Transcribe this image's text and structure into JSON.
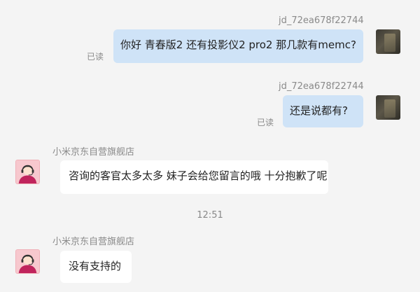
{
  "messages": [
    {
      "sender": "jd_72ea678f22744",
      "text": "你好 青春版2 还有投影仪2 pro2 那几款有memc?",
      "read_status": "已读"
    },
    {
      "sender": "jd_72ea678f22744",
      "text": "还是说都有?",
      "read_status": "已读"
    },
    {
      "sender": "小米京东自营旗舰店",
      "text": "咨询的客官太多太多 妹子会给您留言的哦 十分抱歉了呢"
    },
    {
      "timestamp": "12:51"
    },
    {
      "sender": "小米京东自营旗舰店",
      "text": "没有支持的"
    }
  ],
  "colors": {
    "outgoing_bubble": "#cfe3f7",
    "incoming_bubble": "#ffffff",
    "background": "#f4f4f4",
    "meta_text": "#8a8a8a"
  },
  "icons": {
    "user_avatar": "user-avatar-photo",
    "shop_avatar": "customer-service-headset-avatar"
  }
}
